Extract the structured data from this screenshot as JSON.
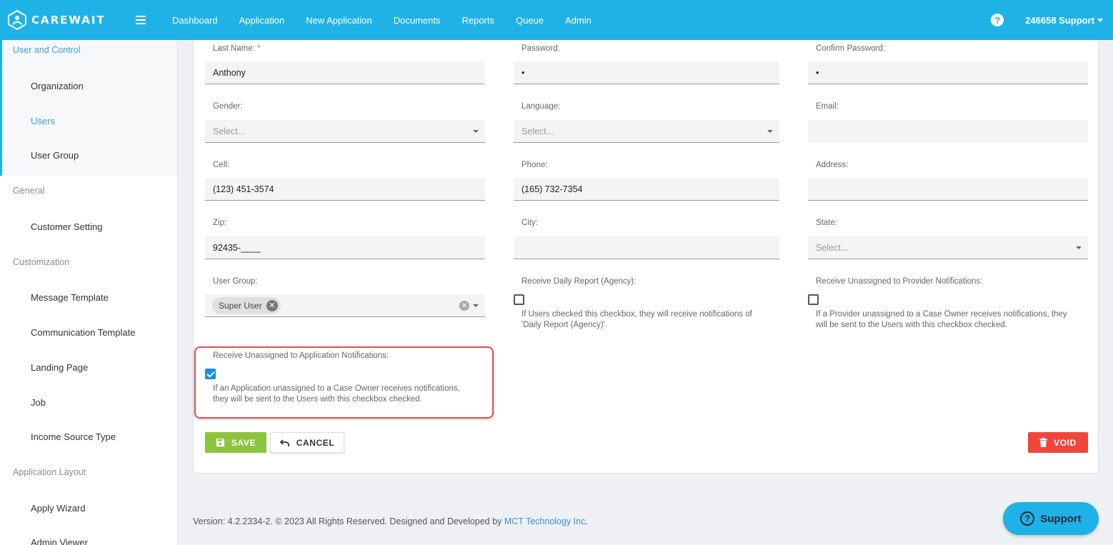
{
  "brand": {
    "name": "CAREWAIT"
  },
  "nav": {
    "items": [
      "Dashboard",
      "Application",
      "New Application",
      "Documents",
      "Reports",
      "Queue",
      "Admin"
    ]
  },
  "user": {
    "label": "246658 Support"
  },
  "sidebar": {
    "groups": [
      {
        "title": "User and Control",
        "items": [
          "Organization",
          "Users",
          "User Group"
        ]
      },
      {
        "title": "General",
        "items": [
          "Customer Setting"
        ]
      },
      {
        "title": "Customization",
        "items": [
          "Message Template",
          "Communication Template",
          "Landing Page",
          "Job",
          "Income Source Type"
        ]
      },
      {
        "title": "Application Layout",
        "items": [
          "Apply Wizard",
          "Admin Viewer"
        ]
      }
    ],
    "active_item": "Users"
  },
  "form": {
    "last_name": {
      "label": "Last Name:",
      "required": "*",
      "value": "Anthony"
    },
    "password": {
      "label": "Password:",
      "value": "•"
    },
    "confirm_password": {
      "label": "Confirm Password:",
      "value": "•"
    },
    "gender": {
      "label": "Gender:",
      "placeholder": "Select..."
    },
    "language": {
      "label": "Language:",
      "placeholder": "Select..."
    },
    "email": {
      "label": "Email:",
      "value": ""
    },
    "cell": {
      "label": "Cell:",
      "value": "(123) 451-3574"
    },
    "phone": {
      "label": "Phone:",
      "value": "(165) 732-7354"
    },
    "address": {
      "label": "Address:",
      "value": ""
    },
    "zip": {
      "label": "Zip:",
      "value": "92435-____"
    },
    "city": {
      "label": "City:",
      "value": ""
    },
    "state": {
      "label": "State:",
      "placeholder": "Select..."
    },
    "user_group": {
      "label": "User Group:",
      "chip": "Super User"
    },
    "daily_report": {
      "label": "Receive Daily Report (Agency):",
      "checked": false,
      "hint_line1": "If Users checked this checkbox, they will receive notifications of",
      "hint_line2": "'Daily Report (Agency)'."
    },
    "unassigned_provider": {
      "label": "Receive Unassigned to Provider Notifications:",
      "checked": false,
      "hint_line1": "If a Provider unassigned to a Case Owner receives notifications, they",
      "hint_line2": "will be sent to the Users with this checkbox checked."
    },
    "unassigned_application": {
      "label": "Receive Unassigned to Application Notifications:",
      "checked": true,
      "hint_line1": "If an Application unassigned to a Case Owner receives notifications,",
      "hint_line2": "they will be sent to the Users with this checkbox checked."
    }
  },
  "buttons": {
    "save": "SAVE",
    "cancel": "CANCEL",
    "void": "VOID"
  },
  "footer": {
    "text": "Version: 4.2.2334-2. © 2023 All Rights Reserved. Designed and Developed by ",
    "link": "MCT Technology Inc",
    "suffix": "."
  },
  "support": {
    "label": "Support"
  },
  "colors": {
    "topbar": "#1fb2e6",
    "save": "#8cc43d",
    "void": "#f0453b",
    "highlight": "#e0504f",
    "active": "#3aa7d9"
  }
}
